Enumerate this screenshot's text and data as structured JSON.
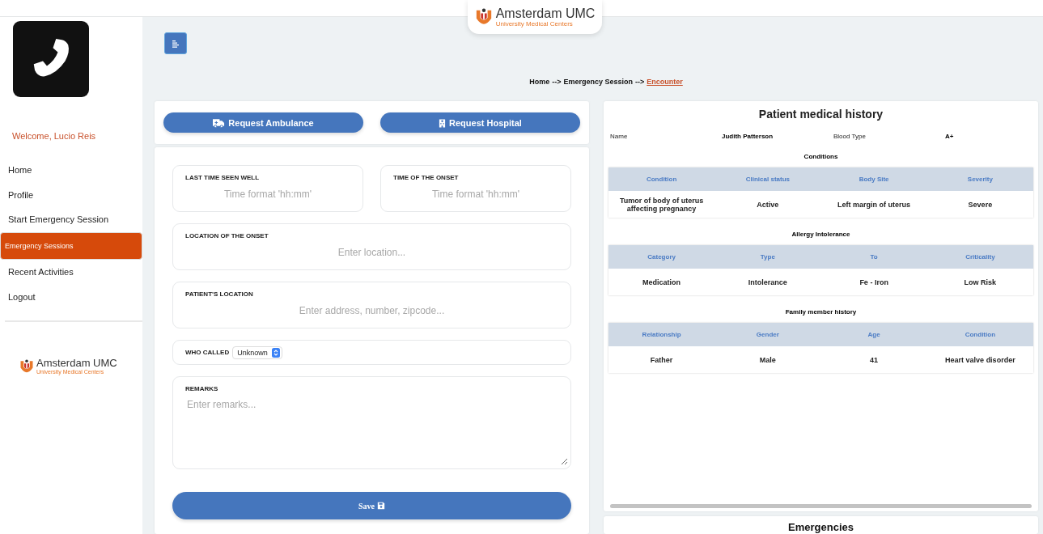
{
  "header": {
    "logo": {
      "name": "Amsterdam UMC",
      "tagline": "University Medical Centers"
    }
  },
  "sidebar": {
    "welcome": "Welcome, Lucio Reis",
    "items": [
      {
        "label": "Home",
        "selected": false
      },
      {
        "label": "Profile",
        "selected": false
      },
      {
        "label": "Start Emergency Session",
        "selected": false
      },
      {
        "label": "Emergency Sessions",
        "selected": true
      },
      {
        "label": "Recent Activities",
        "selected": false
      },
      {
        "label": "Logout",
        "selected": false
      }
    ],
    "logo": {
      "name": "Amsterdam UMC",
      "tagline": "University Medical Centers"
    }
  },
  "breadcrumb": [
    {
      "label": "Home",
      "kind": "text"
    },
    {
      "label": "-->",
      "kind": "separator"
    },
    {
      "label": "Emergency Session",
      "kind": "text"
    },
    {
      "label": "-->",
      "kind": "separator"
    },
    {
      "label": "Encounter",
      "kind": "link"
    }
  ],
  "actions": [
    {
      "label": "Request Ambulance",
      "kind": "ambulance"
    },
    {
      "label": "Request Hospital",
      "kind": "hospital"
    }
  ],
  "form": {
    "fields": [
      {
        "kind": "input",
        "label": "LAST TIME SEEN WELL",
        "placeholder": "Time format 'hh:mm'"
      },
      {
        "kind": "input",
        "label": "TIME OF THE ONSET",
        "placeholder": "Time format 'hh:mm'"
      },
      {
        "kind": "input",
        "label": "LOCATION OF THE ONSET",
        "placeholder": "Enter location..."
      },
      {
        "kind": "input",
        "label": "PATIENT'S LOCATION",
        "placeholder": "Enter address, number, zipcode..."
      },
      {
        "kind": "select",
        "label": "WHO CALLED",
        "value": "Unknown"
      },
      {
        "kind": "textarea",
        "label": "REMARKS",
        "placeholder": "Enter remarks..."
      }
    ],
    "save": "Save"
  },
  "history": {
    "title": "Patient medical history",
    "name_label": "Name",
    "name": "Judith Patterson",
    "blood_label": "Blood Type",
    "blood": "A+",
    "sections": [
      {
        "title": "Conditions",
        "columns": [
          "Condition",
          "Clinical status",
          "Body Site",
          "Severity"
        ],
        "rows": [
          [
            "Tumor of body of uterus affecting pregnancy",
            "Active",
            "Left margin of uterus",
            "Severe"
          ]
        ]
      },
      {
        "title": "Allergy Intolerance",
        "columns": [
          "Category",
          "Type",
          "To",
          "Criticality"
        ],
        "rows": [
          [
            "Medication",
            "Intolerance",
            "Fe - Iron",
            "Low Risk"
          ]
        ]
      },
      {
        "title": "Family member history",
        "columns": [
          "Relationship",
          "Gender",
          "Age",
          "Condition"
        ],
        "rows": [
          [
            "Father",
            "Male",
            "41",
            "Heart valve disorder"
          ]
        ]
      }
    ]
  },
  "emergencies": {
    "title": "Emergencies"
  }
}
